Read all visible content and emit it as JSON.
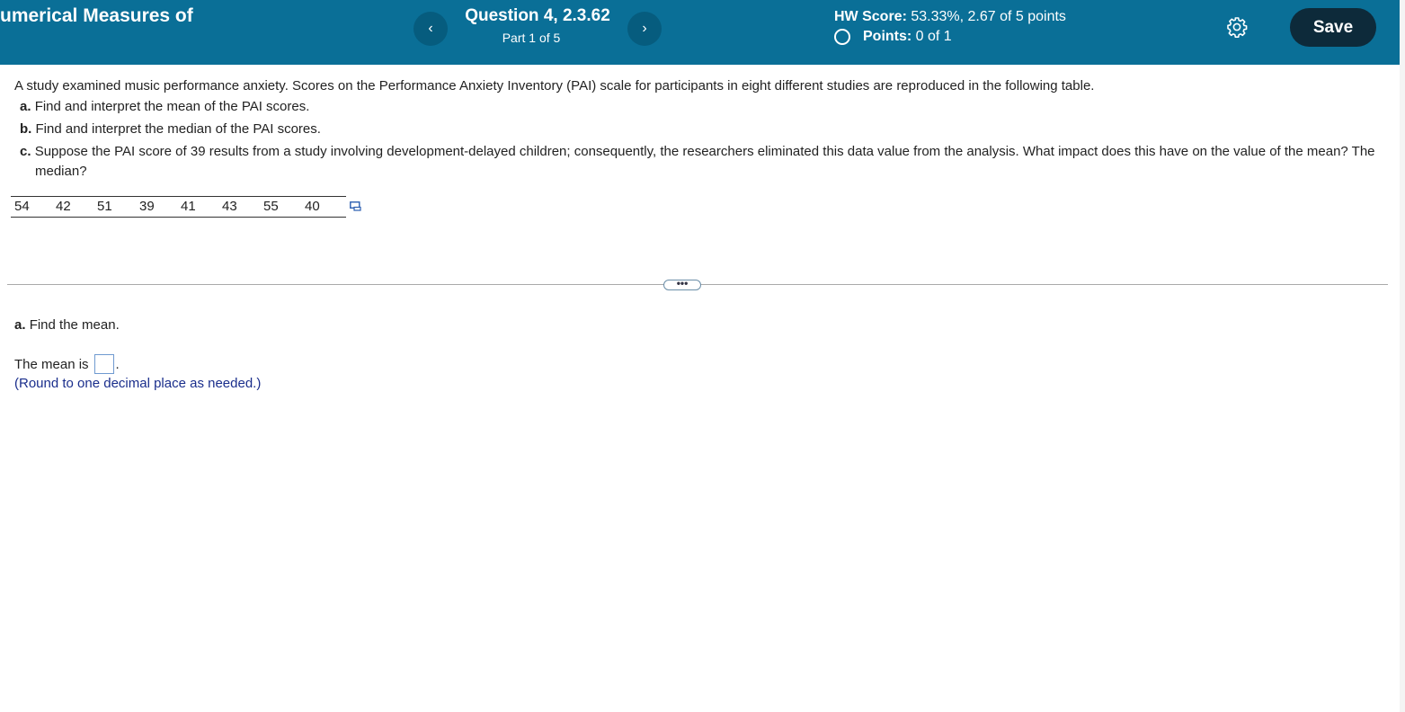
{
  "header": {
    "title": "umerical Measures of",
    "question_title": "Question 4, 2.3.62",
    "question_part": "Part 1 of 5",
    "hw_score_label": "HW Score:",
    "hw_score_value": "53.33%, 2.67 of 5 points",
    "points_label": "Points:",
    "points_value": "0 of 1",
    "prev_glyph": "‹",
    "next_glyph": "›",
    "save_label": "Save",
    "accent": "#0a6f97"
  },
  "problem": {
    "stem": "A study examined music performance anxiety. Scores on the Performance Anxiety Inventory (PAI) scale for participants in eight different studies are reproduced in the following table.",
    "parts": [
      {
        "label": "a.",
        "text": "Find and interpret the mean of the PAI scores."
      },
      {
        "label": "b.",
        "text": "Find and interpret the median of the PAI scores."
      },
      {
        "label": "c.",
        "text": "Suppose the PAI score of 39 results from a study involving development-delayed children; consequently, the researchers eliminated this data value from the analysis. What impact does this have on the value of the mean? The median?"
      }
    ],
    "data": [
      "54",
      "42",
      "51",
      "39",
      "41",
      "43",
      "55",
      "40"
    ]
  },
  "divider": {
    "more_label": "•••"
  },
  "answer": {
    "part_label": "a.",
    "part_text": "Find the mean.",
    "mean_prefix": "The mean is",
    "mean_suffix": ".",
    "hint": "(Round to one decimal place as needed.)"
  }
}
